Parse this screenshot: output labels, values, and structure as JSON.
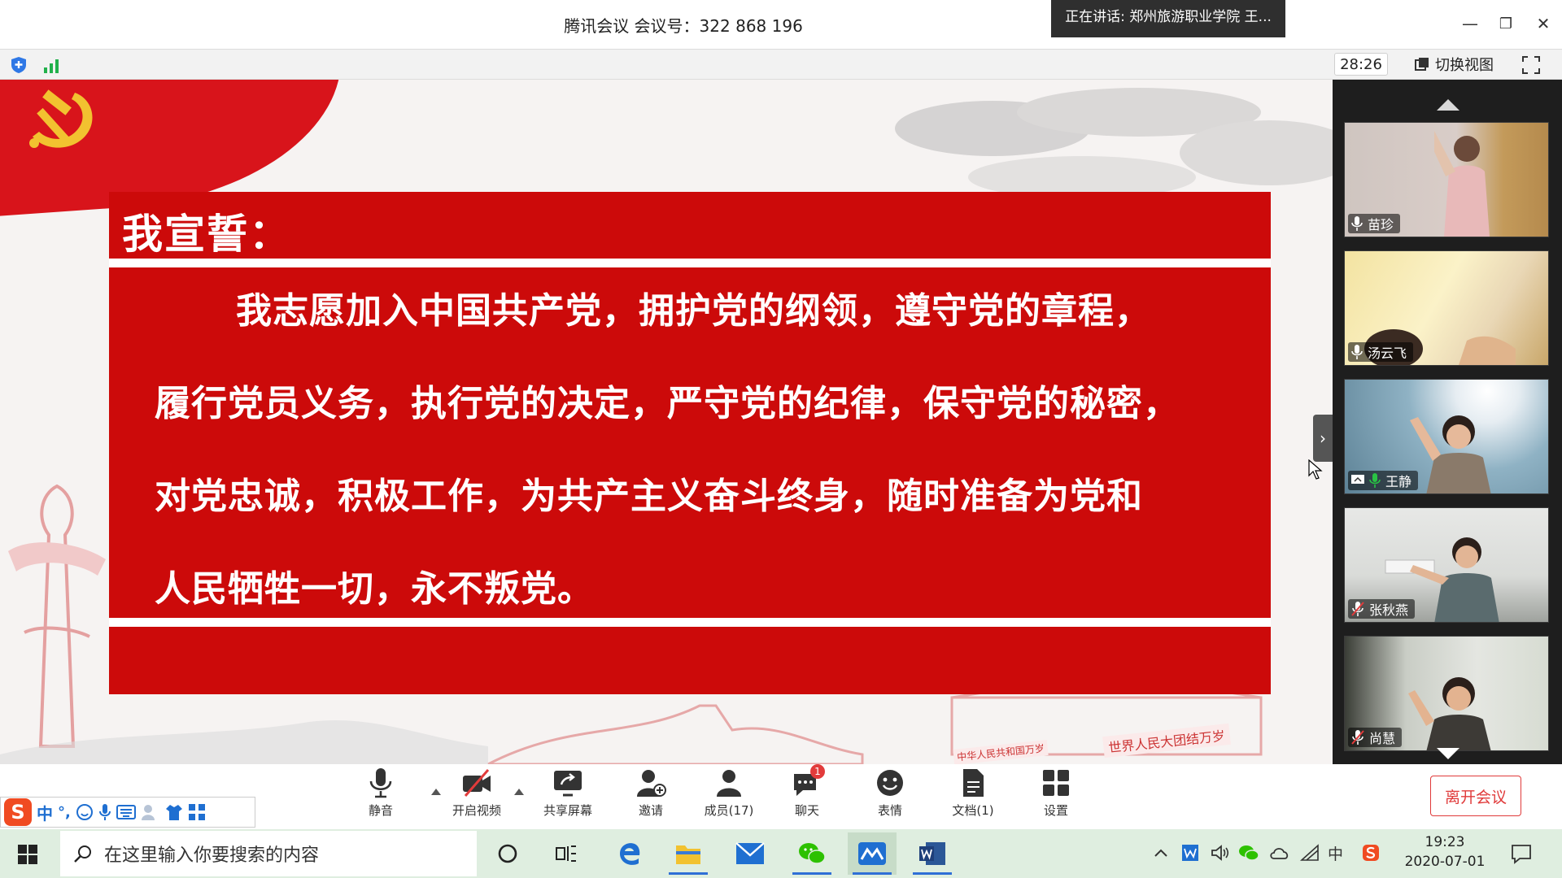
{
  "window": {
    "title": "腾讯会议 会议号：322 868 196",
    "speaker_toast": "正在讲话: 郑州旅游职业学院 王...",
    "minimize": "—",
    "restore": "❐",
    "close": "✕"
  },
  "toolbar": {
    "timer": "28:26",
    "switch_view": "切换视图"
  },
  "slide": {
    "heading": "我宣誓：",
    "lines": [
      "我志愿加入中国共产党，拥护党的纲领，遵守党的章程，",
      "履行党员义务，执行党的决定，严守党的纪律，保守党的秘密，",
      "对党忠诚，积极工作，为共产主义奋斗终身，随时准备为党和",
      "人民牺牲一切，永不叛党。"
    ],
    "banner_left": "中华人民共和国万岁",
    "banner_right": "世界人民大团结万岁",
    "colors": {
      "red": "#cc0a0a",
      "flag_red": "#d8141b",
      "gold": "#f2c230"
    }
  },
  "participants": [
    {
      "name": "苗珍",
      "mic": "on"
    },
    {
      "name": "汤云飞",
      "mic": "on"
    },
    {
      "name": "王静",
      "mic": "speaking"
    },
    {
      "name": "张秋燕",
      "mic": "muted"
    },
    {
      "name": "尚慧",
      "mic": "muted"
    }
  ],
  "controls": {
    "mute": "静音",
    "video": "开启视频",
    "share": "共享屏幕",
    "invite": "邀请",
    "members": "成员(17)",
    "chat": "聊天",
    "chat_badge": "1",
    "reaction": "表情",
    "docs": "文档(1)",
    "settings": "设置",
    "leave": "离开会议"
  },
  "ime": {
    "logo": "S",
    "mode": "中",
    "punct": "°,"
  },
  "taskbar": {
    "search_placeholder": "在这里输入你要搜索的内容",
    "time": "19:23",
    "date": "2020-07-01",
    "ime_indicator": "中"
  }
}
